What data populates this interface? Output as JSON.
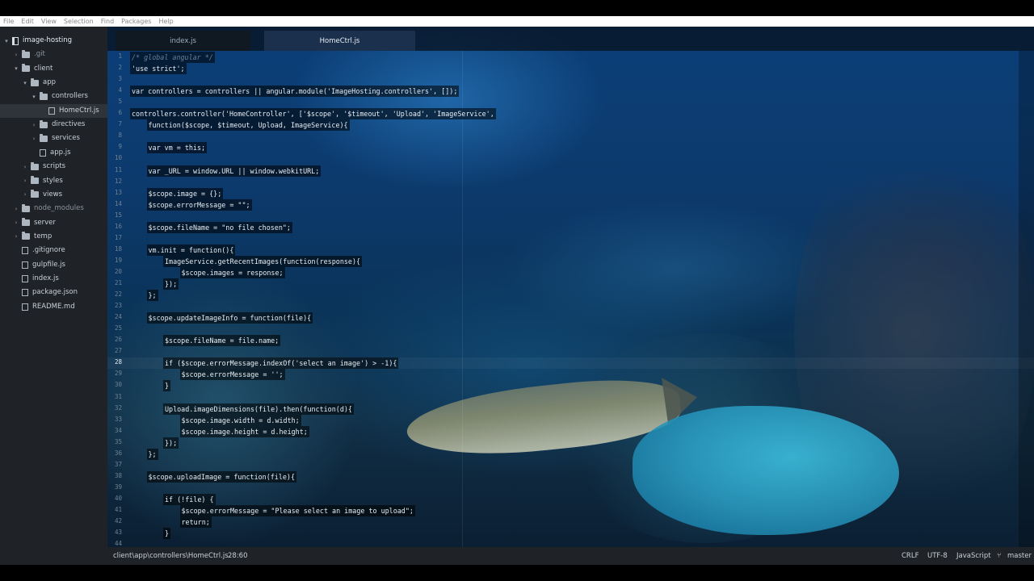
{
  "menu": [
    "File",
    "Edit",
    "View",
    "Selection",
    "Find",
    "Packages",
    "Help"
  ],
  "tree": [
    {
      "label": "image-hosting",
      "type": "repo",
      "chevron": "▾",
      "depth": 0
    },
    {
      "label": ".git",
      "type": "folder",
      "chevron": "›",
      "depth": 1,
      "muted": true
    },
    {
      "label": "client",
      "type": "folder",
      "chevron": "▾",
      "depth": 1
    },
    {
      "label": "app",
      "type": "folder",
      "chevron": "▾",
      "depth": 2
    },
    {
      "label": "controllers",
      "type": "folder",
      "chevron": "▾",
      "depth": 3
    },
    {
      "label": "HomeCtrl.js",
      "type": "file",
      "chevron": "",
      "depth": 4,
      "selected": true
    },
    {
      "label": "directives",
      "type": "folder",
      "chevron": "›",
      "depth": 3
    },
    {
      "label": "services",
      "type": "folder",
      "chevron": "›",
      "depth": 3
    },
    {
      "label": "app.js",
      "type": "file",
      "chevron": "",
      "depth": 3
    },
    {
      "label": "scripts",
      "type": "folder",
      "chevron": "›",
      "depth": 2
    },
    {
      "label": "styles",
      "type": "folder",
      "chevron": "›",
      "depth": 2
    },
    {
      "label": "views",
      "type": "folder",
      "chevron": "›",
      "depth": 2
    },
    {
      "label": "node_modules",
      "type": "folder",
      "chevron": "›",
      "depth": 1,
      "muted": true
    },
    {
      "label": "server",
      "type": "folder",
      "chevron": "›",
      "depth": 1
    },
    {
      "label": "temp",
      "type": "folder",
      "chevron": "›",
      "depth": 1
    },
    {
      "label": ".gitignore",
      "type": "file",
      "chevron": "",
      "depth": 1
    },
    {
      "label": "gulpfile.js",
      "type": "file",
      "chevron": "",
      "depth": 1
    },
    {
      "label": "index.js",
      "type": "file",
      "chevron": "",
      "depth": 1
    },
    {
      "label": "package.json",
      "type": "file",
      "chevron": "",
      "depth": 1
    },
    {
      "label": "README.md",
      "type": "file",
      "chevron": "",
      "depth": 1
    }
  ],
  "tabs": [
    {
      "label": "index.js",
      "active": false
    },
    {
      "label": "HomeCtrl.js",
      "active": true
    }
  ],
  "current_line": "28",
  "lines": [
    {
      "n": "1",
      "indent": 0,
      "text": "/* global angular */",
      "comment": true
    },
    {
      "n": "2",
      "indent": 0,
      "text": "'use strict';"
    },
    {
      "n": "3",
      "indent": 0,
      "text": ""
    },
    {
      "n": "4",
      "indent": 0,
      "text": "var controllers = controllers || angular.module('ImageHosting.controllers', []);"
    },
    {
      "n": "5",
      "indent": 0,
      "text": ""
    },
    {
      "n": "6",
      "indent": 0,
      "text": "controllers.controller('HomeController', ['$scope', '$timeout', 'Upload', 'ImageService',"
    },
    {
      "n": "7",
      "indent": 1,
      "text": "function($scope, $timeout, Upload, ImageService){"
    },
    {
      "n": "8",
      "indent": 0,
      "text": ""
    },
    {
      "n": "9",
      "indent": 1,
      "text": "var vm = this;"
    },
    {
      "n": "10",
      "indent": 0,
      "text": ""
    },
    {
      "n": "11",
      "indent": 1,
      "text": "var _URL = window.URL || window.webkitURL;"
    },
    {
      "n": "12",
      "indent": 0,
      "text": ""
    },
    {
      "n": "13",
      "indent": 1,
      "text": "$scope.image = {};"
    },
    {
      "n": "14",
      "indent": 1,
      "text": "$scope.errorMessage = \"\";"
    },
    {
      "n": "15",
      "indent": 0,
      "text": ""
    },
    {
      "n": "16",
      "indent": 1,
      "text": "$scope.fileName = \"no file chosen\";"
    },
    {
      "n": "17",
      "indent": 0,
      "text": ""
    },
    {
      "n": "18",
      "indent": 1,
      "text": "vm.init = function(){"
    },
    {
      "n": "19",
      "indent": 2,
      "text": "ImageService.getRecentImages(function(response){"
    },
    {
      "n": "20",
      "indent": 3,
      "text": "$scope.images = response;"
    },
    {
      "n": "21",
      "indent": 2,
      "text": "});"
    },
    {
      "n": "22",
      "indent": 1,
      "text": "};"
    },
    {
      "n": "23",
      "indent": 0,
      "text": ""
    },
    {
      "n": "24",
      "indent": 1,
      "text": "$scope.updateImageInfo = function(file){"
    },
    {
      "n": "25",
      "indent": 0,
      "text": ""
    },
    {
      "n": "26",
      "indent": 2,
      "text": "$scope.fileName = file.name;"
    },
    {
      "n": "27",
      "indent": 0,
      "text": ""
    },
    {
      "n": "28",
      "indent": 2,
      "text": "if ($scope.errorMessage.indexOf('select an image') > -1){"
    },
    {
      "n": "29",
      "indent": 3,
      "text": "$scope.errorMessage = '';"
    },
    {
      "n": "30",
      "indent": 2,
      "text": "}"
    },
    {
      "n": "31",
      "indent": 0,
      "text": ""
    },
    {
      "n": "32",
      "indent": 2,
      "text": "Upload.imageDimensions(file).then(function(d){"
    },
    {
      "n": "33",
      "indent": 3,
      "text": "$scope.image.width = d.width;"
    },
    {
      "n": "34",
      "indent": 3,
      "text": "$scope.image.height = d.height;"
    },
    {
      "n": "35",
      "indent": 2,
      "text": "});"
    },
    {
      "n": "36",
      "indent": 1,
      "text": "};"
    },
    {
      "n": "37",
      "indent": 0,
      "text": ""
    },
    {
      "n": "38",
      "indent": 1,
      "text": "$scope.uploadImage = function(file){"
    },
    {
      "n": "39",
      "indent": 0,
      "text": ""
    },
    {
      "n": "40",
      "indent": 2,
      "text": "if (!file) {"
    },
    {
      "n": "41",
      "indent": 3,
      "text": "$scope.errorMessage = \"Please select an image to upload\";"
    },
    {
      "n": "42",
      "indent": 3,
      "text": "return;"
    },
    {
      "n": "43",
      "indent": 2,
      "text": "}"
    },
    {
      "n": "44",
      "indent": 0,
      "text": ""
    }
  ],
  "status": {
    "path": "client\\app\\controllers\\HomeCtrl.js",
    "cursor": "28:60",
    "line_ending": "CRLF",
    "encoding": "UTF-8",
    "grammar": "JavaScript",
    "branch": "master",
    "branch_icon": "git-branch-icon"
  },
  "colors": {
    "sidebar_bg": "#1f2226",
    "menubar_bg": "#ffffff",
    "background_water": "#0c3a6d"
  }
}
